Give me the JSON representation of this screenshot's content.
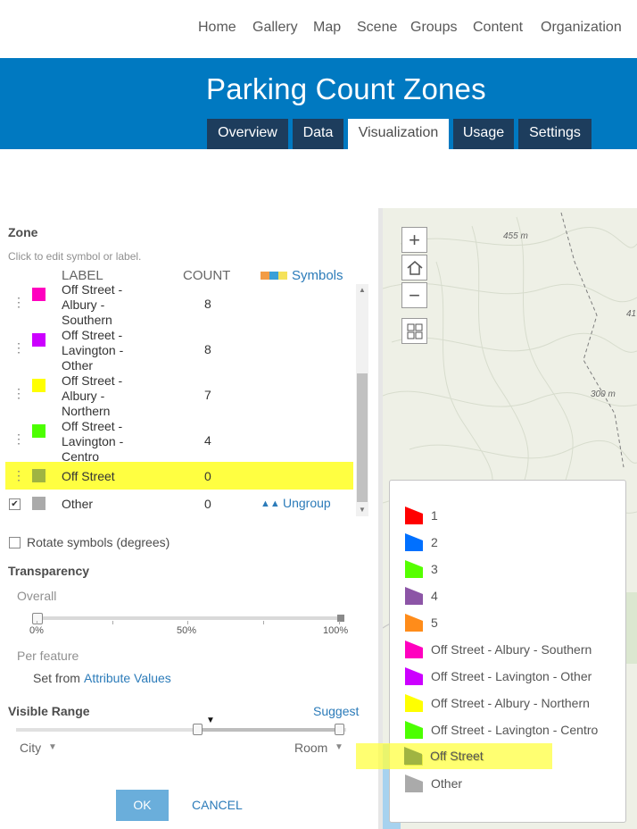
{
  "nav": {
    "items": [
      "Home",
      "Gallery",
      "Map",
      "Scene",
      "Groups",
      "Content",
      "Organization"
    ]
  },
  "banner": {
    "title": "Parking Count Zones",
    "tabs": [
      "Overview",
      "Data",
      "Visualization",
      "Usage",
      "Settings"
    ],
    "active_tab": "Visualization"
  },
  "panel": {
    "heading": "Zone",
    "hint": "Click to edit symbol or label.",
    "col_label": "LABEL",
    "col_count": "COUNT",
    "symbols_link": "Symbols",
    "rows": [
      {
        "label": "Off Street - Albury - Southern",
        "lines": [
          "Off Street -",
          "Albury -",
          "Southern"
        ],
        "count": "8",
        "color": "#ff00bf"
      },
      {
        "label": "Off Street - Lavington - Other",
        "lines": [
          "Off Street -",
          "Lavington -",
          "Other"
        ],
        "count": "8",
        "color": "#cc00ff"
      },
      {
        "label": "Off Street - Albury - Northern",
        "lines": [
          "Off Street -",
          "Albury -",
          "Northern"
        ],
        "count": "7",
        "color": "#ffff00"
      },
      {
        "label": "Off Street - Lavington - Centro",
        "lines": [
          "Off Street -",
          "Lavington -",
          "Centro"
        ],
        "count": "4",
        "color": "#4cff00"
      },
      {
        "label": "Off Street",
        "lines": [
          "Off Street"
        ],
        "count": "0",
        "color": "#a0b442",
        "highlighted": true
      }
    ],
    "other_row": {
      "label": "Other",
      "count": "0",
      "color": "#aaaaaa",
      "checked": true
    },
    "ungroup_link": "Ungroup",
    "rotate_label": "Rotate symbols (degrees)",
    "transparency_heading": "Transparency",
    "overall_label": "Overall",
    "overall_ticks": [
      "0%",
      "50%",
      "100%"
    ],
    "overall_value_percent": 0,
    "per_feature_label": "Per feature",
    "set_from_text": "Set from",
    "attribute_values_link": "Attribute Values",
    "visible_range_heading": "Visible Range",
    "suggest_link": "Suggest",
    "range_min": "City",
    "range_max": "Room",
    "ok_label": "OK",
    "cancel_label": "CANCEL"
  },
  "map": {
    "contour_labels": [
      "455 m",
      "300 m",
      "41"
    ],
    "zoom_in": "+",
    "zoom_out": "−"
  },
  "legend": {
    "items": [
      {
        "label": "1",
        "color": "#ff0000"
      },
      {
        "label": "2",
        "color": "#0070ff"
      },
      {
        "label": "3",
        "color": "#55ff00"
      },
      {
        "label": "4",
        "color": "#8c55a6"
      },
      {
        "label": "5",
        "color": "#ff8c1a"
      },
      {
        "label": "Off Street - Albury - Southern",
        "color": "#ff00bf"
      },
      {
        "label": "Off Street - Lavington - Other",
        "color": "#cc00ff"
      },
      {
        "label": "Off Street - Albury - Northern",
        "color": "#ffff00"
      },
      {
        "label": "Off Street - Lavington - Centro",
        "color": "#4cff00"
      },
      {
        "label": "Off Street",
        "color": "#a0b442",
        "highlighted": true
      },
      {
        "label": "Other",
        "color": "#aaaaaa"
      }
    ]
  },
  "colors": {
    "banner": "#0079c1",
    "tab_dark": "#1d3d5d",
    "link": "#2b7bb9",
    "highlight": "#ffff41",
    "ok_button": "#6aaedb"
  }
}
